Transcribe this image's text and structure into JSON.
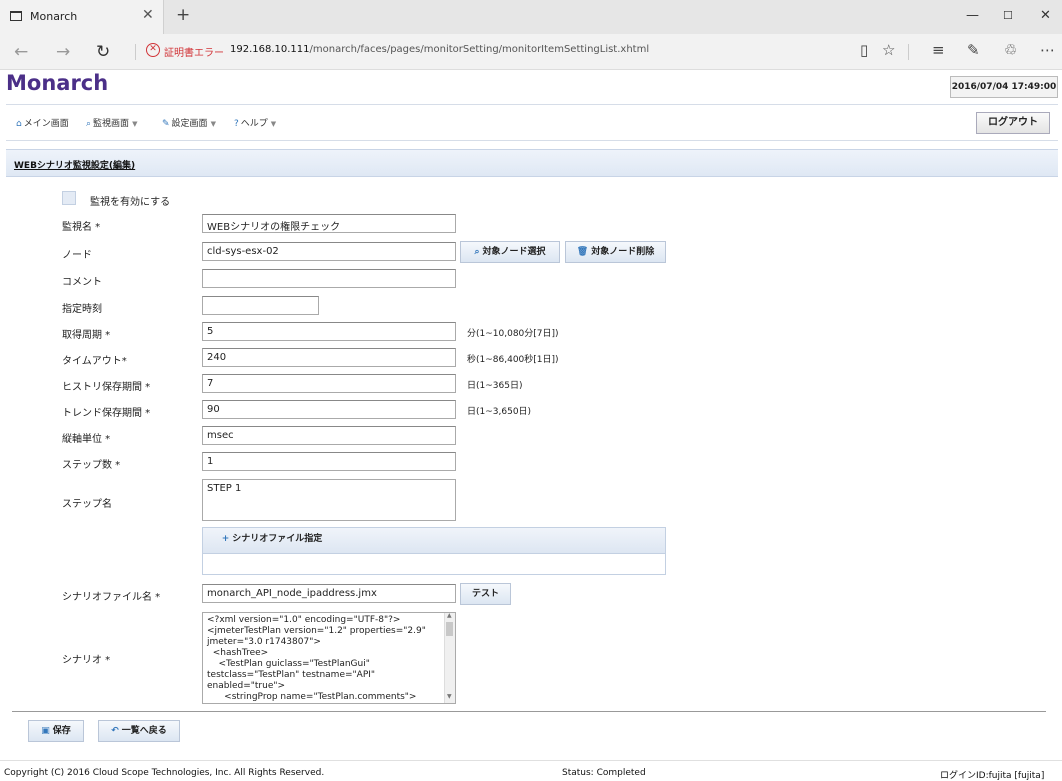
{
  "browser": {
    "tab_title": "Monarch",
    "cert_error": "証明書エラー",
    "url_host": "192.168.10.111",
    "url_path": "/monarch/faces/pages/monitorSetting/monitorItemSettingList.xhtml"
  },
  "app": {
    "logo": "Monarch",
    "datetime": "2016/07/04 17:49:00",
    "logout_label": "ログアウト"
  },
  "menu": {
    "items": [
      {
        "label": "メイン画面",
        "has_dropdown": false
      },
      {
        "label": "監視画面",
        "has_dropdown": true
      },
      {
        "label": "設定画面",
        "has_dropdown": true
      },
      {
        "label": "ヘルプ",
        "has_dropdown": true
      }
    ]
  },
  "page": {
    "title": "WEBシナリオ監視設定(編集)",
    "enable_label": "監視を有効にする",
    "enable_checked": false
  },
  "form": {
    "monitor_name": {
      "label": "監視名 *",
      "value": "WEBシナリオの権限チェック"
    },
    "node": {
      "label": "ノード",
      "value": "cld-sys-esx-02",
      "select_label": "対象ノード選択",
      "delete_label": "対象ノード削除"
    },
    "comment": {
      "label": "コメント",
      "value": ""
    },
    "time": {
      "label": "指定時刻",
      "value": ""
    },
    "interval": {
      "label": "取得周期 *",
      "value": "5",
      "hint": "分(1~10,080分[7日])"
    },
    "timeout": {
      "label": "タイムアウト*",
      "value": "240",
      "hint": "秒(1~86,400秒[1日])"
    },
    "history": {
      "label": "ヒストリ保存期間 *",
      "value": "7",
      "hint": "日(1~365日)"
    },
    "trend": {
      "label": "トレンド保存期間 *",
      "value": "90",
      "hint": "日(1~3,650日)"
    },
    "unit": {
      "label": "縦軸単位 *",
      "value": "msec"
    },
    "step_count": {
      "label": "ステップ数 *",
      "value": "1"
    },
    "step_name": {
      "label": "ステップ名",
      "value": "STEP 1"
    },
    "scenario_file_button": "シナリオファイル指定",
    "scenario_file": {
      "label": "シナリオファイル名 *",
      "value": "monarch_API_node_ipaddress.jmx",
      "test_label": "テスト"
    },
    "scenario": {
      "label": "シナリオ *",
      "value": "<?xml version=\"1.0\" encoding=\"UTF-8\"?>\n<jmeterTestPlan version=\"1.2\" properties=\"2.9\" jmeter=\"3.0 r1743807\">\n  <hashTree>\n    <TestPlan guiclass=\"TestPlanGui\" testclass=\"TestPlan\" testname=\"API\" enabled=\"true\">\n      <stringProp name=\"TestPlan.comments\"></stringProp>"
    }
  },
  "actions": {
    "save_label": "保存",
    "back_label": "一覧へ戻る"
  },
  "footer": {
    "copyright": "Copyright (C) 2016 Cloud Scope Technologies, Inc. All Rights Reserved.",
    "status": "Status: Completed",
    "login": "ログインID:fujita [fujita]"
  }
}
